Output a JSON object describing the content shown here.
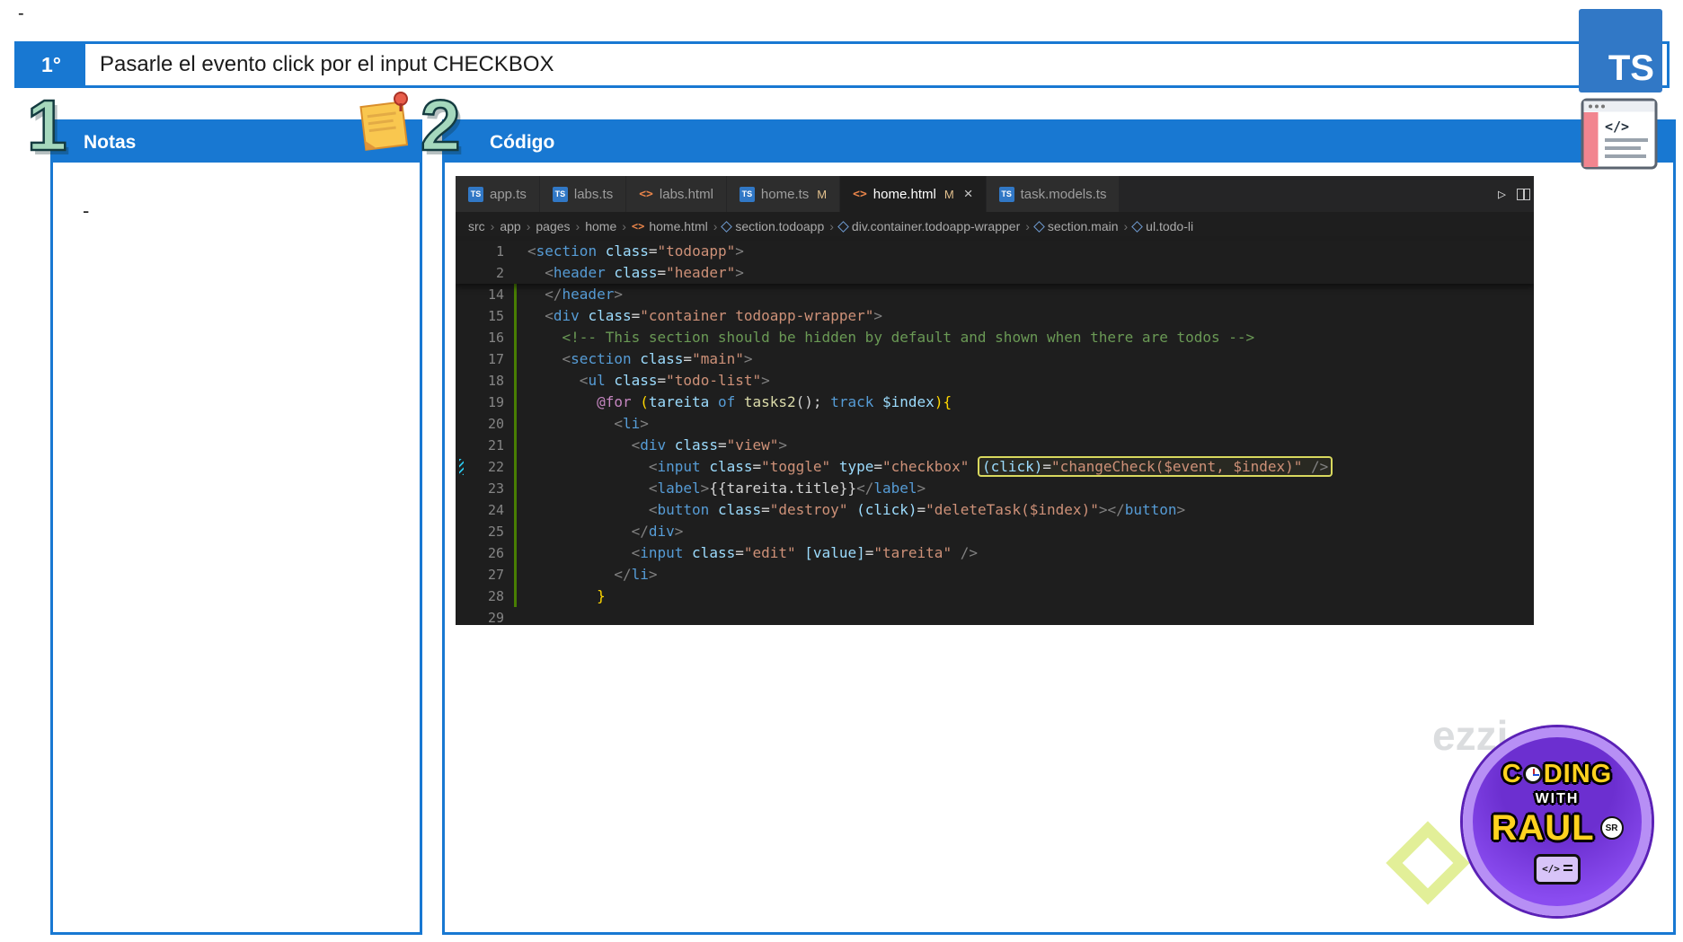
{
  "page": {
    "top_dash": "-",
    "accent": "#1878d2",
    "header": {
      "step": "1°",
      "title": "Pasarle el evento click por el input CHECKBOX"
    },
    "ts_logo_text": "TS",
    "watermark_text": "ezzi"
  },
  "notes_panel": {
    "number": "1",
    "title": "Notas",
    "content_dash": "-"
  },
  "code_panel": {
    "number": "2",
    "title": "Código"
  },
  "editor": {
    "icons": {
      "ts": "TS",
      "html": "<>"
    },
    "modified_glyph": "M",
    "close_glyph": "×",
    "actions": {
      "run": "▷"
    },
    "tabs": [
      {
        "label": "app.ts",
        "icon": "ts"
      },
      {
        "label": "labs.ts",
        "icon": "ts"
      },
      {
        "label": "labs.html",
        "icon": "html"
      },
      {
        "label": "home.ts",
        "icon": "ts",
        "modified": true
      },
      {
        "label": "home.html",
        "icon": "html",
        "modified": true,
        "active": true
      },
      {
        "label": "task.models.ts",
        "icon": "ts"
      }
    ],
    "breadcrumb": {
      "separator": "›",
      "items": [
        {
          "label": "src"
        },
        {
          "label": "app"
        },
        {
          "label": "pages"
        },
        {
          "label": "home"
        },
        {
          "label": "home.html",
          "icon": "html"
        },
        {
          "label": "section.todoapp",
          "icon": "symbol"
        },
        {
          "label": "div.container.todoapp-wrapper",
          "icon": "symbol"
        },
        {
          "label": "section.main",
          "icon": "symbol"
        },
        {
          "label": "ul.todo-li",
          "icon": "symbol"
        }
      ]
    },
    "sticky_lines": [
      {
        "n": 1,
        "ind": 0,
        "tokens": [
          [
            "p",
            "<"
          ],
          [
            "t",
            "section"
          ],
          [
            "w",
            " "
          ],
          [
            "a",
            "class"
          ],
          [
            "w",
            "="
          ],
          [
            "s",
            "\"todoapp\""
          ],
          [
            "p",
            ">"
          ]
        ]
      },
      {
        "n": 2,
        "ind": 2,
        "tokens": [
          [
            "p",
            "<"
          ],
          [
            "t",
            "header"
          ],
          [
            "w",
            " "
          ],
          [
            "a",
            "class"
          ],
          [
            "w",
            "="
          ],
          [
            "s",
            "\"header\""
          ],
          [
            "p",
            ">"
          ]
        ]
      }
    ],
    "lines": [
      {
        "n": 14,
        "ind": 2,
        "g": true,
        "tokens": [
          [
            "p",
            "</"
          ],
          [
            "t",
            "header"
          ],
          [
            "p",
            ">"
          ]
        ]
      },
      {
        "n": 15,
        "ind": 2,
        "g": true,
        "tokens": [
          [
            "p",
            "<"
          ],
          [
            "t",
            "div"
          ],
          [
            "w",
            " "
          ],
          [
            "a",
            "class"
          ],
          [
            "w",
            "="
          ],
          [
            "s",
            "\"container todoapp-wrapper\""
          ],
          [
            "p",
            ">"
          ]
        ]
      },
      {
        "n": 16,
        "ind": 4,
        "g": true,
        "tokens": [
          [
            "c",
            "<!-- This section should be hidden by default and shown when there are todos -->"
          ]
        ]
      },
      {
        "n": 17,
        "ind": 4,
        "g": true,
        "tokens": [
          [
            "p",
            "<"
          ],
          [
            "t",
            "section"
          ],
          [
            "w",
            " "
          ],
          [
            "a",
            "class"
          ],
          [
            "w",
            "="
          ],
          [
            "s",
            "\"main\""
          ],
          [
            "p",
            ">"
          ]
        ]
      },
      {
        "n": 18,
        "ind": 6,
        "g": true,
        "tokens": [
          [
            "p",
            "<"
          ],
          [
            "t",
            "ul"
          ],
          [
            "w",
            " "
          ],
          [
            "a",
            "class"
          ],
          [
            "w",
            "="
          ],
          [
            "s",
            "\"todo-list\""
          ],
          [
            "p",
            ">"
          ]
        ]
      },
      {
        "n": 19,
        "ind": 8,
        "g": true,
        "tokens": [
          [
            "k",
            "@for"
          ],
          [
            "w",
            " "
          ],
          [
            "b",
            "("
          ],
          [
            "a",
            "tareita"
          ],
          [
            "w",
            " "
          ],
          [
            "t",
            "of"
          ],
          [
            "w",
            " "
          ],
          [
            "f",
            "tasks2"
          ],
          [
            "w",
            "();"
          ],
          [
            "w",
            " "
          ],
          [
            "t",
            "track"
          ],
          [
            "w",
            " "
          ],
          [
            "a",
            "$index"
          ],
          [
            "b",
            "){"
          ]
        ]
      },
      {
        "n": 20,
        "ind": 10,
        "g": true,
        "tokens": [
          [
            "p",
            "<"
          ],
          [
            "t",
            "li"
          ],
          [
            "p",
            ">"
          ]
        ]
      },
      {
        "n": 21,
        "ind": 12,
        "g": true,
        "tokens": [
          [
            "p",
            "<"
          ],
          [
            "t",
            "div"
          ],
          [
            "w",
            " "
          ],
          [
            "a",
            "class"
          ],
          [
            "w",
            "="
          ],
          [
            "s",
            "\"view\""
          ],
          [
            "p",
            ">"
          ]
        ]
      },
      {
        "n": 22,
        "ind": 14,
        "g": true,
        "mark": true,
        "tokens": [
          [
            "p",
            "<"
          ],
          [
            "t",
            "input"
          ],
          [
            "w",
            " "
          ],
          [
            "a",
            "class"
          ],
          [
            "w",
            "="
          ],
          [
            "s",
            "\"toggle\""
          ],
          [
            "w",
            " "
          ],
          [
            "a",
            "type"
          ],
          [
            "w",
            "="
          ],
          [
            "s",
            "\"checkbox\""
          ],
          [
            "w",
            " "
          ]
        ],
        "boxed": [
          [
            "a",
            "(click)"
          ],
          [
            "w",
            "="
          ],
          [
            "s",
            "\"changeCheck($event, $index)\""
          ],
          [
            "w",
            " "
          ],
          [
            "p",
            "/>"
          ]
        ]
      },
      {
        "n": 23,
        "ind": 14,
        "g": true,
        "tokens": [
          [
            "p",
            "<"
          ],
          [
            "t",
            "label"
          ],
          [
            "p",
            ">"
          ],
          [
            "w",
            "{{tareita.title}}"
          ],
          [
            "p",
            "</"
          ],
          [
            "t",
            "label"
          ],
          [
            "p",
            ">"
          ]
        ]
      },
      {
        "n": 24,
        "ind": 14,
        "g": true,
        "tokens": [
          [
            "p",
            "<"
          ],
          [
            "t",
            "button"
          ],
          [
            "w",
            " "
          ],
          [
            "a",
            "class"
          ],
          [
            "w",
            "="
          ],
          [
            "s",
            "\"destroy\""
          ],
          [
            "w",
            " "
          ],
          [
            "a",
            "(click)"
          ],
          [
            "w",
            "="
          ],
          [
            "s",
            "\"deleteTask($index)\""
          ],
          [
            "p",
            "></"
          ],
          [
            "t",
            "button"
          ],
          [
            "p",
            ">"
          ]
        ]
      },
      {
        "n": 25,
        "ind": 12,
        "g": true,
        "tokens": [
          [
            "p",
            "</"
          ],
          [
            "t",
            "div"
          ],
          [
            "p",
            ">"
          ]
        ]
      },
      {
        "n": 26,
        "ind": 12,
        "g": true,
        "tokens": [
          [
            "p",
            "<"
          ],
          [
            "t",
            "input"
          ],
          [
            "w",
            " "
          ],
          [
            "a",
            "class"
          ],
          [
            "w",
            "="
          ],
          [
            "s",
            "\"edit\""
          ],
          [
            "w",
            " "
          ],
          [
            "a",
            "[value]"
          ],
          [
            "w",
            "="
          ],
          [
            "s",
            "\"tareita\""
          ],
          [
            "w",
            " "
          ],
          [
            "p",
            "/>"
          ]
        ]
      },
      {
        "n": 27,
        "ind": 10,
        "g": true,
        "tokens": [
          [
            "p",
            "</"
          ],
          [
            "t",
            "li"
          ],
          [
            "p",
            ">"
          ]
        ]
      },
      {
        "n": 28,
        "ind": 8,
        "g": true,
        "tokens": [
          [
            "b",
            "}"
          ]
        ]
      },
      {
        "n": 29,
        "ind": 0,
        "tokens": []
      }
    ]
  },
  "badge": {
    "top_pre": "C",
    "top_post": "DING",
    "mid": "WITH",
    "name": "RAUL",
    "sr": "SR",
    "win_glyph": "</>"
  }
}
